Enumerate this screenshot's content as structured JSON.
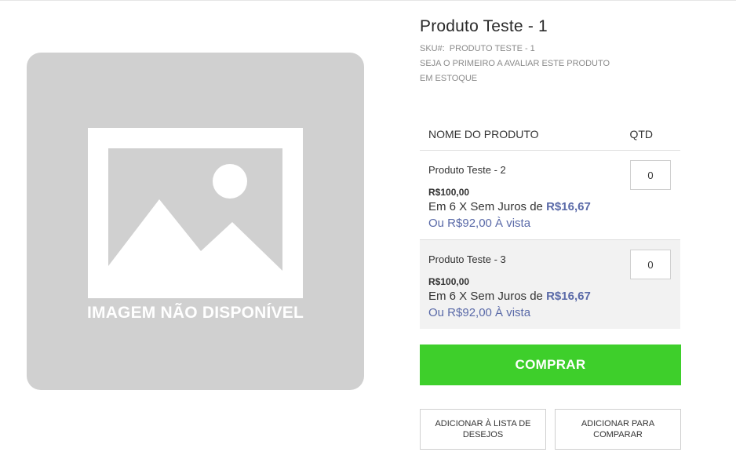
{
  "image": {
    "placeholder_text": "IMAGEM NÃO DISPONÍVEL",
    "icon": "image-placeholder-icon"
  },
  "product": {
    "title": "Produto Teste - 1",
    "sku_label": "SKU#:",
    "sku_value": "PRODUTO TESTE - 1",
    "review_link": "SEJA O PRIMEIRO A AVALIAR ESTE PRODUTO",
    "stock_status": "EM ESTOQUE"
  },
  "grouped_table": {
    "col_name": "NOME DO PRODUTO",
    "col_qty": "QTD",
    "rows": [
      {
        "name": "Produto Teste - 2",
        "price": "R$100,00",
        "installment_text": "Em 6 X Sem Juros de",
        "installment_value": "R$16,67",
        "cash_price": "Ou R$92,00 À vista",
        "qty": "0"
      },
      {
        "name": "Produto Teste - 3",
        "price": "R$100,00",
        "installment_text": "Em 6 X Sem Juros de",
        "installment_value": "R$16,67",
        "cash_price": "Ou R$92,00 À vista",
        "qty": "0"
      }
    ]
  },
  "actions": {
    "buy_label": "COMPRAR",
    "wishlist_label": "ADICIONAR À LISTA DE DESEJOS",
    "compare_label": "ADICIONAR PARA COMPARAR"
  },
  "colors": {
    "buy_button": "#3ecf2b",
    "accent_price": "#5a6aa8",
    "placeholder_bg": "#d0d0d0"
  }
}
